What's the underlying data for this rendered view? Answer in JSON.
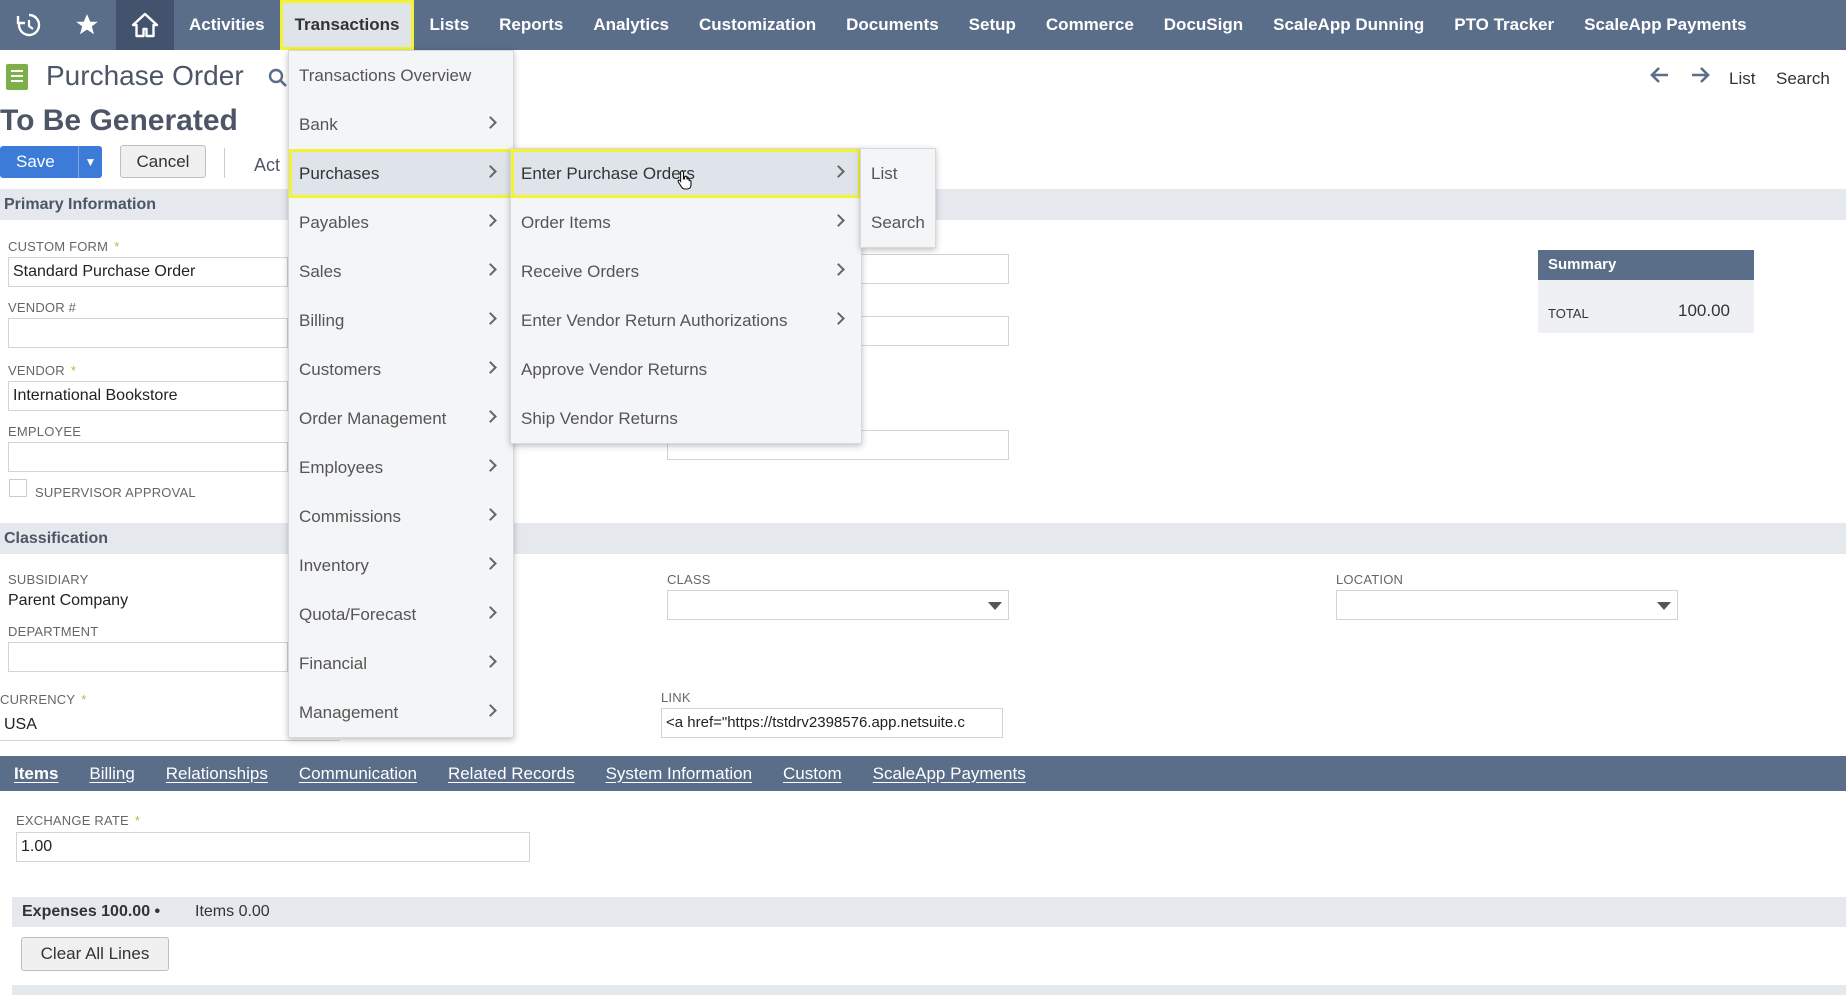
{
  "nav": {
    "items": [
      "Activities",
      "Transactions",
      "Lists",
      "Reports",
      "Analytics",
      "Customization",
      "Documents",
      "Setup",
      "Commerce",
      "DocuSign",
      "ScaleApp Dunning",
      "PTO Tracker",
      "ScaleApp Payments"
    ],
    "active_index": 1,
    "icons": [
      "history-icon",
      "star-icon",
      "home-icon"
    ]
  },
  "header": {
    "title": "Purchase Order",
    "status": "To Be Generated",
    "nav_list": "List",
    "nav_search": "Search"
  },
  "buttons": {
    "save": "Save",
    "cancel": "Cancel",
    "actions": "Act",
    "clear_all_lines": "Clear All Lines"
  },
  "primary": {
    "section_title": "Primary Information",
    "custom_form_label": "CUSTOM FORM",
    "custom_form_value": "Standard Purchase Order",
    "vendor_no_label": "VENDOR #",
    "vendor_label": "VENDOR",
    "vendor_value": "International Bookstore",
    "employee_label": "EMPLOYEE",
    "supervisor_label": "SUPERVISOR APPROVAL",
    "required_mark": "*"
  },
  "summary": {
    "title": "Summary",
    "total_label": "TOTAL",
    "total_value": "100.00"
  },
  "classification": {
    "section_title": "Classification",
    "subsidiary_label": "SUBSIDIARY",
    "subsidiary_value": "Parent Company",
    "department_label": "DEPARTMENT",
    "class_label": "CLASS",
    "location_label": "LOCATION",
    "currency_label": "CURRENCY",
    "currency_value": "USA",
    "link_label": "LINK",
    "link_value": "<a href=\"https://tstdrv2398576.app.netsuite.c"
  },
  "subtabs": [
    "Items",
    "Billing",
    "Relationships",
    "Communication",
    "Related Records",
    "System Information",
    "Custom",
    "ScaleApp Payments"
  ],
  "items_tab": {
    "exchange_rate_label": "EXCHANGE RATE",
    "exchange_rate_value": "1.00",
    "expenses_tab": "Expenses 100.00 •",
    "items_tab": "Items 0.00"
  },
  "menu_l1": [
    "Transactions Overview",
    "Bank",
    "Purchases",
    "Payables",
    "Sales",
    "Billing",
    "Customers",
    "Order Management",
    "Employees",
    "Commissions",
    "Inventory",
    "Quota/Forecast",
    "Financial",
    "Management"
  ],
  "menu_l2": [
    "Enter Purchase Orders",
    "Order Items",
    "Receive Orders",
    "Enter Vendor Return Authorizations",
    "Approve Vendor Returns",
    "Ship Vendor Returns"
  ],
  "menu_l3": [
    "List",
    "Search"
  ],
  "colors": {
    "nav_bg": "#5a6d89",
    "highlight": "#f3f333",
    "save_blue": "#3d7bd8",
    "required_green": "#a6c63a"
  }
}
